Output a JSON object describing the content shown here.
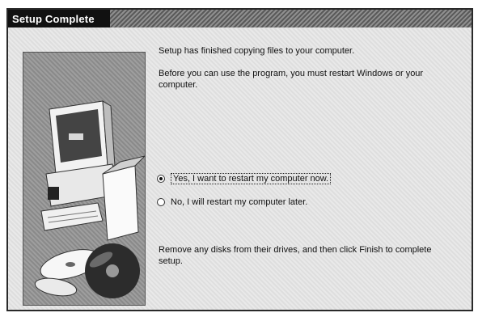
{
  "window": {
    "title": "Setup Complete"
  },
  "content": {
    "line1": "Setup has finished copying files to your computer.",
    "line2": "Before you can use the program, you must restart Windows or your computer.",
    "footer": "Remove any disks from their drives, and then click Finish to complete setup."
  },
  "options": {
    "restart_now": {
      "label": "Yes, I want to restart my computer now.",
      "selected": true
    },
    "restart_later": {
      "label": "No, I will restart my computer later.",
      "selected": false
    }
  },
  "icons": {
    "art": "computer-setup-illustration"
  }
}
